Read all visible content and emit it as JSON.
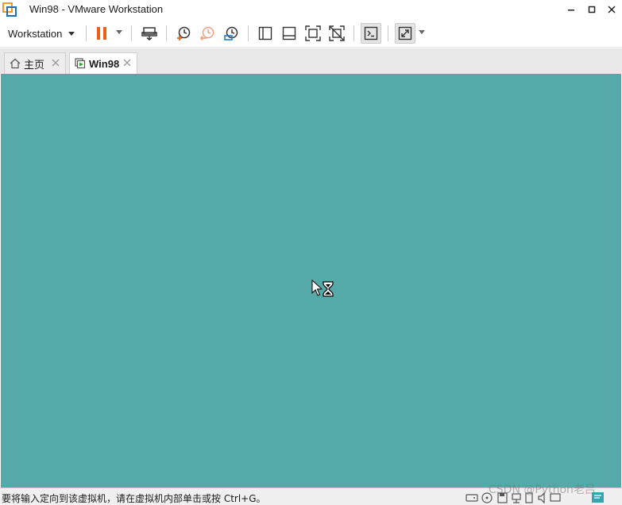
{
  "window": {
    "title": "Win98 - VMware Workstation"
  },
  "toolbar": {
    "menu_label": "Workstation",
    "icons": [
      "pause-icon",
      "send-keys-icon",
      "snapshot-take-icon",
      "snapshot-revert-icon",
      "snapshot-manager-icon",
      "view-library-icon",
      "view-thumbnail-icon",
      "fullscreen-icon",
      "unity-icon",
      "console-icon",
      "stretch-icon"
    ]
  },
  "tabs": [
    {
      "label": "主页",
      "icon": "home-icon",
      "active": false
    },
    {
      "label": "Win98",
      "icon": "vm-running-icon",
      "active": true
    }
  ],
  "vm": {
    "background_color": "#55a9a9",
    "cursor": "busy-arrow-hourglass"
  },
  "statusbar": {
    "message": "要将输入定向到该虚拟机，请在虚拟机内部单击或按 Ctrl+G。",
    "devices": [
      "hard-disk-icon",
      "cd-rom-icon",
      "floppy-icon",
      "network-icon",
      "usb-icon",
      "sound-icon",
      "display-icon",
      "message-log-icon"
    ]
  },
  "watermark": "CSDN @Python老吕",
  "colors": {
    "accent_orange": "#e8601c",
    "vm_teal": "#55a9a9"
  }
}
